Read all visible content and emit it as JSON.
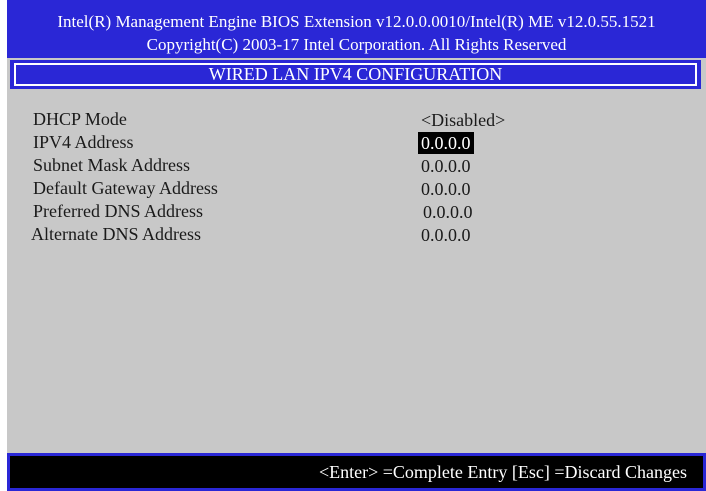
{
  "header": {
    "line1": "Intel(R) Management Engine BIOS Extension v12.0.0.0010/Intel(R) ME v12.0.55.1521",
    "line2": "Copyright(C) 2003-17 Intel Corporation. All Rights Reserved"
  },
  "title": "WIRED LAN IPV4 CONFIGURATION",
  "settings": [
    {
      "label": "DHCP Mode",
      "value": "<Disabled>"
    },
    {
      "label": "IPV4 Address",
      "value": "0.0.0.0",
      "selected": true
    },
    {
      "label": "Subnet Mask Address",
      "value": "0.0.0.0"
    },
    {
      "label": "Default Gateway Address",
      "value": "0.0.0.0"
    },
    {
      "label": "Preferred DNS Address",
      "value": "0.0.0.0"
    },
    {
      "label": "Alternate DNS Address",
      "value": "0.0.0.0"
    }
  ],
  "footer": {
    "hint": "<Enter> =Complete Entry  [Esc] =Discard Changes"
  },
  "colors": {
    "bios_blue": "#2a27d6",
    "panel_gray": "#c8c8c8",
    "highlight": "#000000"
  }
}
